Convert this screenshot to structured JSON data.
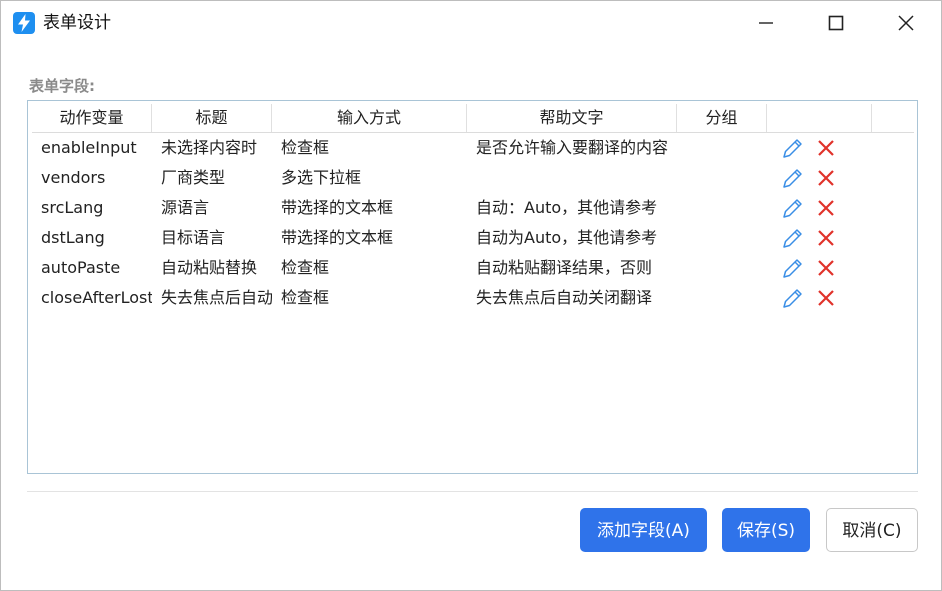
{
  "window": {
    "title": "表单设计",
    "accent": "#1e8ff0"
  },
  "section": {
    "label": "表单字段:"
  },
  "table": {
    "columns": [
      "动作变量",
      "标题",
      "输入方式",
      "帮助文字",
      "分组",
      ""
    ],
    "rows": [
      {
        "var": "enableInput",
        "title": "未选择内容时",
        "input": "检查框",
        "help": "是否允许输入要翻译的内容",
        "group": ""
      },
      {
        "var": "vendors",
        "title": "厂商类型",
        "input": "多选下拉框",
        "help": "",
        "group": ""
      },
      {
        "var": "srcLang",
        "title": "源语言",
        "input": "带选择的文本框",
        "help": "自动：Auto，其他请参考",
        "group": ""
      },
      {
        "var": "dstLang",
        "title": "目标语言",
        "input": "带选择的文本框",
        "help": "自动为Auto，其他请参考",
        "group": ""
      },
      {
        "var": "autoPaste",
        "title": "自动粘贴替换",
        "input": "检查框",
        "help": "自动粘贴翻译结果，否则",
        "group": ""
      },
      {
        "var": "closeAfterLostFocus",
        "title": "失去焦点后自动",
        "input": "检查框",
        "help": "失去焦点后自动关闭翻译",
        "group": ""
      }
    ],
    "row_actions": {
      "edit_icon": "pencil-icon",
      "delete_icon": "x-icon",
      "edit_color": "#3a8ee6",
      "delete_color": "#e0322a"
    }
  },
  "footer": {
    "add_label": "添加字段(A)",
    "save_label": "保存(S)",
    "cancel_label": "取消(C)",
    "primary_color": "#2f73ea"
  }
}
